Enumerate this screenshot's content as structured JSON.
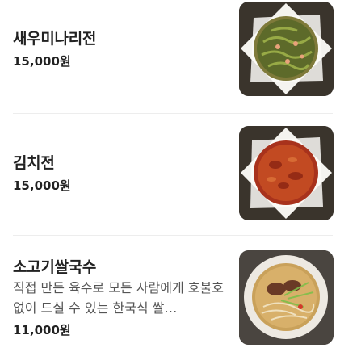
{
  "menu": {
    "items": [
      {
        "name": "새우미나리전",
        "price": "15,000원",
        "image_icon": "seafood-pancake-photo"
      },
      {
        "name": "김치전",
        "price": "15,000원",
        "image_icon": "kimchi-pancake-photo"
      },
      {
        "name": "소고기쌀국수",
        "description": "직접 만든 육수로 모든 사람에게 호불호 없이 드실 수 있는 한국식 쌀…",
        "price": "11,000원",
        "image_icon": "beef-rice-noodle-soup-photo"
      }
    ]
  }
}
